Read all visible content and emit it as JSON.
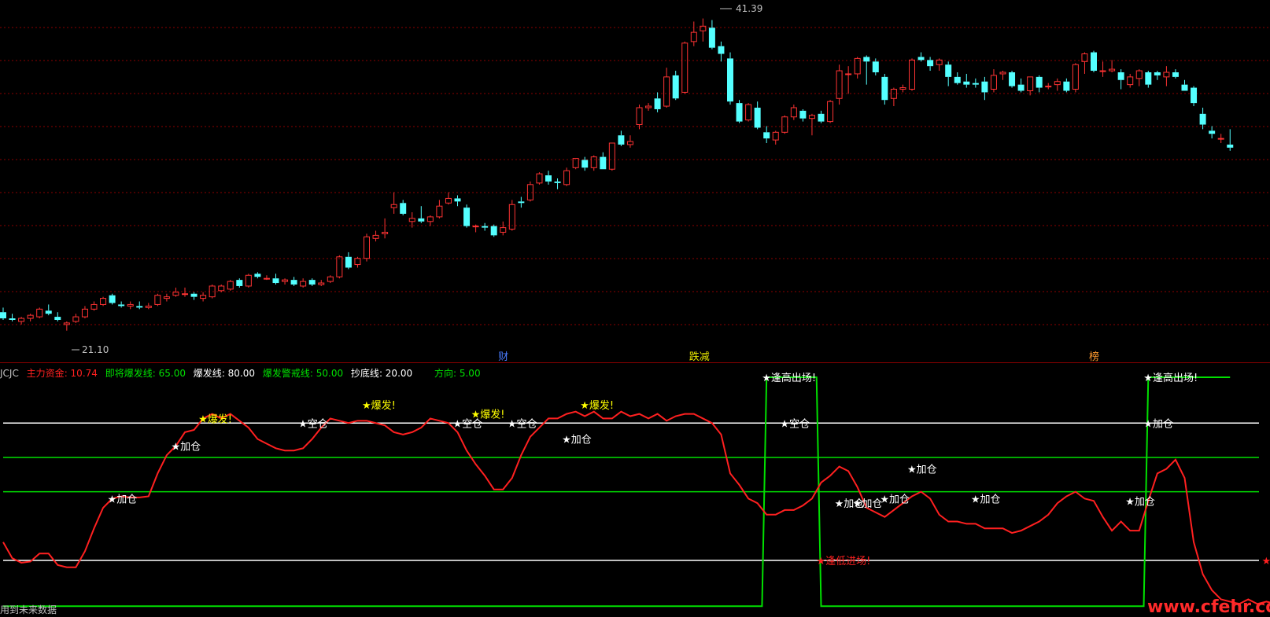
{
  "chart_data": [
    {
      "type": "candlestick",
      "title": "",
      "ylim": [
        19.5,
        42.5
      ],
      "high_annotation": "41.39",
      "low_annotation": "21.10",
      "events": [
        {
          "label": "财",
          "color": "#4a7cff",
          "index": 55
        },
        {
          "label": "跌减",
          "color": "#e6e600",
          "index": 76
        },
        {
          "label": "榜",
          "color": "#ff9a2e",
          "index": 120
        }
      ],
      "candles": [
        [
          22.3,
          22.6,
          21.8,
          21.9
        ],
        [
          21.9,
          22.2,
          21.7,
          21.8
        ],
        [
          21.7,
          22.0,
          21.5,
          21.9
        ],
        [
          21.9,
          22.2,
          21.7,
          22.1
        ],
        [
          22.0,
          22.6,
          21.9,
          22.5
        ],
        [
          22.4,
          22.8,
          22.1,
          22.2
        ],
        [
          22.0,
          22.3,
          21.7,
          21.8
        ],
        [
          21.5,
          21.7,
          21.1,
          21.6
        ],
        [
          21.7,
          22.2,
          21.6,
          22.0
        ],
        [
          22.0,
          22.7,
          21.9,
          22.5
        ],
        [
          22.5,
          23.0,
          22.4,
          22.8
        ],
        [
          22.8,
          23.3,
          22.7,
          23.2
        ],
        [
          23.4,
          23.5,
          22.8,
          22.9
        ],
        [
          22.8,
          23.0,
          22.6,
          22.7
        ],
        [
          22.7,
          23.0,
          22.5,
          22.8
        ],
        [
          22.7,
          23.0,
          22.5,
          22.6
        ],
        [
          22.6,
          22.9,
          22.5,
          22.7
        ],
        [
          22.8,
          23.5,
          22.7,
          23.4
        ],
        [
          23.2,
          23.5,
          23.0,
          23.3
        ],
        [
          23.4,
          23.9,
          23.3,
          23.6
        ],
        [
          23.5,
          23.9,
          23.3,
          23.5
        ],
        [
          23.5,
          23.6,
          23.1,
          23.3
        ],
        [
          23.2,
          23.6,
          23.0,
          23.4
        ],
        [
          23.3,
          24.1,
          23.2,
          24.0
        ],
        [
          23.7,
          24.1,
          23.6,
          24.0
        ],
        [
          23.8,
          24.4,
          23.7,
          24.3
        ],
        [
          24.4,
          24.5,
          23.9,
          24.0
        ],
        [
          24.0,
          24.8,
          23.9,
          24.7
        ],
        [
          24.8,
          24.9,
          24.5,
          24.6
        ],
        [
          24.5,
          24.7,
          24.4,
          24.5
        ],
        [
          24.5,
          24.8,
          24.1,
          24.2
        ],
        [
          24.3,
          24.5,
          24.1,
          24.4
        ],
        [
          24.4,
          24.6,
          24.0,
          24.1
        ],
        [
          24.0,
          24.5,
          23.9,
          24.3
        ],
        [
          24.4,
          24.5,
          24.0,
          24.1
        ],
        [
          24.1,
          24.4,
          24.0,
          24.2
        ],
        [
          24.3,
          24.7,
          24.2,
          24.6
        ],
        [
          24.6,
          26.0,
          24.5,
          25.9
        ],
        [
          25.9,
          26.2,
          25.1,
          25.2
        ],
        [
          25.4,
          25.9,
          25.2,
          25.8
        ],
        [
          25.8,
          27.4,
          25.6,
          27.2
        ],
        [
          27.1,
          27.6,
          26.9,
          27.3
        ],
        [
          27.4,
          28.4,
          27.1,
          27.5
        ],
        [
          29.1,
          30.1,
          28.7,
          29.3
        ],
        [
          29.4,
          29.6,
          28.6,
          28.7
        ],
        [
          28.2,
          28.8,
          27.8,
          28.4
        ],
        [
          28.4,
          29.2,
          28.1,
          28.2
        ],
        [
          28.2,
          28.6,
          27.9,
          28.5
        ],
        [
          28.5,
          29.6,
          28.4,
          29.2
        ],
        [
          29.4,
          30.1,
          29.3,
          29.7
        ],
        [
          29.7,
          29.9,
          29.2,
          29.5
        ],
        [
          29.1,
          29.3,
          27.8,
          27.9
        ],
        [
          27.9,
          28.0,
          27.5,
          27.9
        ],
        [
          27.9,
          28.1,
          27.6,
          27.8
        ],
        [
          27.9,
          28.0,
          27.2,
          27.3
        ],
        [
          27.5,
          28.2,
          27.3,
          27.8
        ],
        [
          27.7,
          29.6,
          27.6,
          29.3
        ],
        [
          29.5,
          29.8,
          29.1,
          29.4
        ],
        [
          29.6,
          30.8,
          29.5,
          30.6
        ],
        [
          30.7,
          31.4,
          30.6,
          31.3
        ],
        [
          31.2,
          31.5,
          30.6,
          30.8
        ],
        [
          30.8,
          31.0,
          30.3,
          30.7
        ],
        [
          30.6,
          31.7,
          30.5,
          31.5
        ],
        [
          31.7,
          32.3,
          31.6,
          32.3
        ],
        [
          32.2,
          32.4,
          31.5,
          31.7
        ],
        [
          31.7,
          32.5,
          31.5,
          32.4
        ],
        [
          32.4,
          32.7,
          31.6,
          31.6
        ],
        [
          31.6,
          33.3,
          31.5,
          33.3
        ],
        [
          33.8,
          34.1,
          33.1,
          33.2
        ],
        [
          33.2,
          33.8,
          33.0,
          33.4
        ],
        [
          34.5,
          35.8,
          34.2,
          35.6
        ],
        [
          35.6,
          35.9,
          35.4,
          35.7
        ],
        [
          36.2,
          36.6,
          35.3,
          35.5
        ],
        [
          35.7,
          38.2,
          35.6,
          37.6
        ],
        [
          37.7,
          38.0,
          36.1,
          36.2
        ],
        [
          36.6,
          39.9,
          36.5,
          39.8
        ],
        [
          39.9,
          41.2,
          39.6,
          40.5
        ],
        [
          40.6,
          41.4,
          39.9,
          40.9
        ],
        [
          40.8,
          41.3,
          39.4,
          39.5
        ],
        [
          39.6,
          39.9,
          38.6,
          39.1
        ],
        [
          38.8,
          39.2,
          35.8,
          36.0
        ],
        [
          35.9,
          36.1,
          34.6,
          34.7
        ],
        [
          34.8,
          35.9,
          34.7,
          35.8
        ],
        [
          35.6,
          36.0,
          34.2,
          34.3
        ],
        [
          34.0,
          34.4,
          33.3,
          33.6
        ],
        [
          33.5,
          34.1,
          33.2,
          34.0
        ],
        [
          34.0,
          35.1,
          33.9,
          35.0
        ],
        [
          35.0,
          35.8,
          34.8,
          35.6
        ],
        [
          35.4,
          35.5,
          34.7,
          34.9
        ],
        [
          34.9,
          35.2,
          33.8,
          35.1
        ],
        [
          35.2,
          35.4,
          34.6,
          34.7
        ],
        [
          34.7,
          36.1,
          34.6,
          36.0
        ],
        [
          36.2,
          38.4,
          35.8,
          38.0
        ],
        [
          37.8,
          38.3,
          36.5,
          37.8
        ],
        [
          37.8,
          38.9,
          37.5,
          38.8
        ],
        [
          38.9,
          39.0,
          37.1,
          38.6
        ],
        [
          38.6,
          38.8,
          37.7,
          37.9
        ],
        [
          37.6,
          37.8,
          35.8,
          36.1
        ],
        [
          36.2,
          36.9,
          35.7,
          36.8
        ],
        [
          36.8,
          37.1,
          36.6,
          36.9
        ],
        [
          36.8,
          38.8,
          36.7,
          38.7
        ],
        [
          38.9,
          39.2,
          38.6,
          38.7
        ],
        [
          38.7,
          38.9,
          38.0,
          38.3
        ],
        [
          38.4,
          38.8,
          38.0,
          38.7
        ],
        [
          38.4,
          38.6,
          37.0,
          37.6
        ],
        [
          37.6,
          37.9,
          37.1,
          37.2
        ],
        [
          37.3,
          37.8,
          36.9,
          37.1
        ],
        [
          37.2,
          37.5,
          36.9,
          37.1
        ],
        [
          37.3,
          37.6,
          36.1,
          36.6
        ],
        [
          36.8,
          38.1,
          36.6,
          37.7
        ],
        [
          37.8,
          38.0,
          37.4,
          37.9
        ],
        [
          37.9,
          38.0,
          36.9,
          37.0
        ],
        [
          37.1,
          37.5,
          36.6,
          36.7
        ],
        [
          36.7,
          37.6,
          36.4,
          37.6
        ],
        [
          37.6,
          37.7,
          36.6,
          36.9
        ],
        [
          37.0,
          37.2,
          36.8,
          37.0
        ],
        [
          37.1,
          37.5,
          36.7,
          37.3
        ],
        [
          37.3,
          37.5,
          36.6,
          36.7
        ],
        [
          36.8,
          38.5,
          36.6,
          38.4
        ],
        [
          38.6,
          39.2,
          37.8,
          39.1
        ],
        [
          39.2,
          39.3,
          37.9,
          38.0
        ],
        [
          38.0,
          38.6,
          37.6,
          38.0
        ],
        [
          38.0,
          38.7,
          37.9,
          38.1
        ],
        [
          37.9,
          38.1,
          36.8,
          37.4
        ],
        [
          37.1,
          37.8,
          36.9,
          37.6
        ],
        [
          37.5,
          38.1,
          37.0,
          38.0
        ],
        [
          37.9,
          38.0,
          36.9,
          37.1
        ],
        [
          37.9,
          38.0,
          37.4,
          37.7
        ],
        [
          37.6,
          38.3,
          37.0,
          37.9
        ],
        [
          37.9,
          38.1,
          37.5,
          37.6
        ],
        [
          37.1,
          37.4,
          36.7,
          36.7
        ],
        [
          36.9,
          37.0,
          35.7,
          35.9
        ],
        [
          35.2,
          35.6,
          34.2,
          34.5
        ],
        [
          34.1,
          34.4,
          33.6,
          33.9
        ],
        [
          33.6,
          33.9,
          33.3,
          33.6
        ],
        [
          33.2,
          34.2,
          32.8,
          33.0
        ]
      ]
    },
    {
      "type": "line",
      "title": "JCJC",
      "ylim": [
        -3,
        100
      ],
      "series": [
        {
          "name": "主力资金",
          "color": "#ff2020",
          "values": [
            28,
            21,
            19,
            19.5,
            23,
            23,
            18,
            17,
            17,
            24,
            34,
            43,
            47,
            48,
            47.5,
            47.5,
            48,
            58,
            66,
            70,
            76,
            77,
            82,
            84,
            82,
            84,
            81,
            78,
            73,
            71,
            69,
            68,
            68,
            69,
            73,
            78,
            82,
            81,
            80,
            81,
            81,
            80,
            79,
            76,
            75,
            76,
            78,
            82,
            81,
            80,
            76,
            68,
            62,
            57,
            51,
            51,
            56,
            66,
            74,
            78,
            82,
            82,
            84,
            85,
            83,
            85,
            82,
            82,
            85,
            83,
            84,
            82,
            84,
            81,
            83,
            84,
            84,
            82,
            80,
            75,
            58,
            53,
            47,
            45,
            40,
            40,
            42,
            42,
            44,
            47,
            54,
            57,
            61,
            59,
            52,
            43,
            41,
            39,
            42,
            45,
            48,
            50,
            47,
            40,
            37,
            37,
            36,
            36,
            34,
            34,
            34,
            32,
            33,
            35,
            37,
            40,
            45,
            48,
            50,
            47,
            46,
            39,
            33,
            37,
            33,
            33,
            46,
            58,
            60,
            64,
            56,
            28,
            14,
            7,
            3,
            2,
            1,
            3,
            1,
            2,
            1,
            2,
            3
          ]
        },
        {
          "name": "即将爆发线",
          "color": "#00e000",
          "values": [
            65
          ]
        },
        {
          "name": "爆发线",
          "color": "#ffffff",
          "values": [
            80
          ]
        },
        {
          "name": "爆发警戒线",
          "color": "#00e000",
          "values": [
            50
          ]
        },
        {
          "name": "抄底线",
          "color": "#ffffff",
          "values": [
            20
          ]
        },
        {
          "name": "方向",
          "color": "#00e000",
          "values": [
            5
          ]
        }
      ],
      "header_values": {
        "main_fund": "10.74",
        "burst_soon": "65.00",
        "burst": "80.00",
        "burst_warn": "50.00",
        "bottom": "20.00",
        "direction": "5.00"
      },
      "signals": [
        {
          "i": 12,
          "y": 47,
          "text": "加仓",
          "color": "#ffffff"
        },
        {
          "i": 19,
          "y": 70,
          "text": "加仓",
          "color": "#ffffff"
        },
        {
          "i": 22,
          "y": 82,
          "text": "爆发!",
          "color": "#ffff00"
        },
        {
          "i": 33,
          "y": 80,
          "text": "空仓",
          "color": "#ffffff"
        },
        {
          "i": 40,
          "y": 88,
          "text": "爆发!",
          "color": "#ffff00"
        },
        {
          "i": 50,
          "y": 80,
          "text": "空仓",
          "color": "#ffffff"
        },
        {
          "i": 52,
          "y": 84,
          "text": "爆发!",
          "color": "#ffff00"
        },
        {
          "i": 56,
          "y": 80,
          "text": "空仓",
          "color": "#ffffff"
        },
        {
          "i": 62,
          "y": 73,
          "text": "加仓",
          "color": "#ffffff"
        },
        {
          "i": 64,
          "y": 88,
          "text": "爆发!",
          "color": "#ffff00"
        },
        {
          "i": 86,
          "y": 80,
          "text": "空仓",
          "color": "#ffffff"
        },
        {
          "i": 92,
          "y": 45,
          "text": "加仓",
          "color": "#ffffff"
        },
        {
          "i": 94,
          "y": 45,
          "text": "加仓",
          "color": "#ffffff"
        },
        {
          "i": 97,
          "y": 47,
          "text": "加仓",
          "color": "#ffffff"
        },
        {
          "i": 100,
          "y": 60,
          "text": "加仓",
          "color": "#ffffff"
        },
        {
          "i": 107,
          "y": 47,
          "text": "加仓",
          "color": "#ffffff"
        },
        {
          "i": 124,
          "y": 46,
          "text": "加仓",
          "color": "#ffffff"
        },
        {
          "i": 126,
          "y": 80,
          "text": "加仓",
          "color": "#ffffff"
        },
        {
          "i": 90,
          "y": 20,
          "text": "逢低进场!",
          "color": "#ff2020"
        },
        {
          "i": 139,
          "y": 20,
          "text": "逢低进场!",
          "color": "#ff2020"
        },
        {
          "i": 84,
          "y": 100,
          "text": "逢高出场!",
          "color": "#ffffff"
        },
        {
          "i": 126,
          "y": 100,
          "text": "逢高出场!",
          "color": "#ffffff"
        }
      ]
    }
  ],
  "footer_note": "用到未来数据",
  "watermark": "www.cfehr.com",
  "colors": {
    "up": "#ff3333",
    "down": "#54ffff",
    "grid": "#8b0000",
    "bg": "#000000"
  }
}
